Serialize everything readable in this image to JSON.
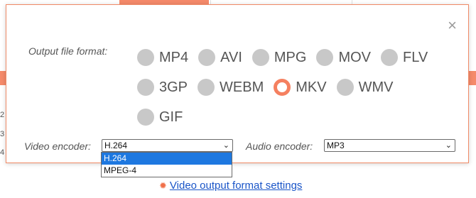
{
  "background": {
    "row_numbers": [
      "2",
      "3",
      "4"
    ],
    "link_text": "Video output format settings",
    "link_icon": "gear-icon"
  },
  "dialog": {
    "close_label": "×",
    "format_label": "Output file format:",
    "formats_rows": [
      [
        {
          "label": "MP4",
          "checked": false
        },
        {
          "label": "AVI",
          "checked": false
        },
        {
          "label": "MPG",
          "checked": false
        },
        {
          "label": "MOV",
          "checked": false
        },
        {
          "label": "FLV",
          "checked": false
        }
      ],
      [
        {
          "label": "3GP",
          "checked": false
        },
        {
          "label": "WEBM",
          "checked": false
        },
        {
          "label": "MKV",
          "checked": true
        },
        {
          "label": "WMV",
          "checked": false
        }
      ],
      [
        {
          "label": "GIF",
          "checked": false
        }
      ]
    ],
    "video_encoder": {
      "label": "Video encoder:",
      "value": "H.264",
      "options": [
        {
          "label": "H.264",
          "selected": true
        },
        {
          "label": "MPEG-4",
          "selected": false
        }
      ]
    },
    "audio_encoder": {
      "label": "Audio encoder:",
      "value": "MP3"
    }
  },
  "colors": {
    "accent": "#f58060",
    "link": "#1a55c8",
    "selected_option": "#1e78e0"
  }
}
